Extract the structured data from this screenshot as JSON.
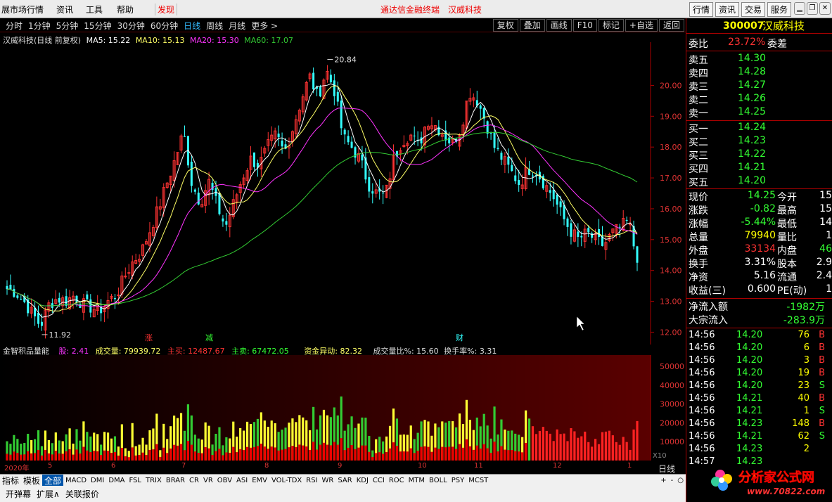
{
  "menu": {
    "items": [
      "展市场行情",
      "资讯",
      "工具",
      "帮助",
      "发现"
    ],
    "center1": "通达信金融终端",
    "center2": "汉威科技",
    "right_tabs": [
      "行情",
      "资讯",
      "交易",
      "服务"
    ]
  },
  "periods": [
    "分时",
    "1分钟",
    "5分钟",
    "15分钟",
    "30分钟",
    "60分钟",
    "日线",
    "周线",
    "月线",
    "更多 >"
  ],
  "active_period": "日线",
  "tools": [
    "复权",
    "叠加",
    "画线",
    "F10",
    "标记",
    "+自选",
    "返回"
  ],
  "chart_info": {
    "name": "汉威科技(日线 前复权)",
    "ma5": "MA5: 15.22",
    "ma10": "MA10: 15.13",
    "ma20": "MA20: 15.30",
    "ma60": "MA60: 17.07"
  },
  "colors": {
    "up": "#ff3333",
    "down": "#33ffff",
    "ma5": "#ffffff",
    "ma10": "#ffff66",
    "ma20": "#ff33ff",
    "ma60": "#33cc33"
  },
  "annotations": {
    "high": "20.84",
    "low": "11.92",
    "marks": [
      "涨",
      "减",
      "财"
    ]
  },
  "indicator": {
    "name": "金智积品量能",
    "gu": "股: 2.41",
    "vol": "成交量: 79939.72",
    "buy": "主买: 12487.67",
    "sell": "主卖: 67472.05",
    "fund": "资金异动: 82.32",
    "ratio": "成交量比%: 15.60",
    "turnover": "换手率%: 3.31"
  },
  "vol_axis_scale": "X10",
  "date_labels": [
    "2020年",
    "5",
    "6",
    "7",
    "8",
    "9",
    "10",
    "11",
    "12",
    "1"
  ],
  "day_label": "日线",
  "ind_tabs": [
    "指标",
    "模板",
    "全部",
    "MACD",
    "DMI",
    "DMA",
    "FSL",
    "TRIX",
    "BRAR",
    "CR",
    "VR",
    "OBV",
    "ASI",
    "EMV",
    "VOL-TDX",
    "RSI",
    "WR",
    "SAR",
    "KDJ",
    "CCI",
    "ROC",
    "MTM",
    "BOLL",
    "PSY",
    "MCST"
  ],
  "bottom": [
    "开弹幕",
    "扩展∧",
    "关联报价"
  ],
  "stock": {
    "code": "300007",
    "name": "汉威科技",
    "weibi_label": "委比",
    "weibi": "23.72%",
    "weicha_label": "委差"
  },
  "asks": [
    {
      "label": "卖五",
      "price": "14.30"
    },
    {
      "label": "卖四",
      "price": "14.28"
    },
    {
      "label": "卖三",
      "price": "14.27"
    },
    {
      "label": "卖二",
      "price": "14.26"
    },
    {
      "label": "卖一",
      "price": "14.25"
    }
  ],
  "bids": [
    {
      "label": "买一",
      "price": "14.24"
    },
    {
      "label": "买二",
      "price": "14.23"
    },
    {
      "label": "买三",
      "price": "14.22"
    },
    {
      "label": "买四",
      "price": "14.21"
    },
    {
      "label": "买五",
      "price": "14.20"
    }
  ],
  "quote": [
    {
      "l1": "现价",
      "v1": "14.25",
      "l2": "今开",
      "v2": "15"
    },
    {
      "l1": "涨跌",
      "v1": "-0.82",
      "l2": "最高",
      "v2": "15"
    },
    {
      "l1": "涨幅",
      "v1": "-5.44%",
      "l2": "最低",
      "v2": "14"
    },
    {
      "l1": "总量",
      "v1": "79940",
      "l2": "量比",
      "v2": "1"
    },
    {
      "l1": "外盘",
      "v1": "33134",
      "l2": "内盘",
      "v2": "46"
    },
    {
      "l1": "换手",
      "v1": "3.31%",
      "l2": "股本",
      "v2": "2.9"
    },
    {
      "l1": "净资",
      "v1": "5.16",
      "l2": "流通",
      "v2": "2.4"
    },
    {
      "l1": "收益(三)",
      "v1": "0.600",
      "l2": "PE(动)",
      "v2": "1"
    }
  ],
  "flow": [
    {
      "label": "净流入额",
      "value": "-1982万"
    },
    {
      "label": "大宗流入",
      "value": "-283.9万"
    }
  ],
  "ticks": [
    {
      "t": "14:56",
      "p": "14.20",
      "v": "76",
      "d": "B"
    },
    {
      "t": "14:56",
      "p": "14.20",
      "v": "6",
      "d": "B"
    },
    {
      "t": "14:56",
      "p": "14.20",
      "v": "3",
      "d": "B"
    },
    {
      "t": "14:56",
      "p": "14.20",
      "v": "19",
      "d": "B"
    },
    {
      "t": "14:56",
      "p": "14.20",
      "v": "23",
      "d": "S"
    },
    {
      "t": "14:56",
      "p": "14.21",
      "v": "40",
      "d": "B"
    },
    {
      "t": "14:56",
      "p": "14.21",
      "v": "1",
      "d": "S"
    },
    {
      "t": "14:56",
      "p": "14.23",
      "v": "148",
      "d": "B"
    },
    {
      "t": "14:56",
      "p": "14.21",
      "v": "62",
      "d": "S"
    },
    {
      "t": "14:56",
      "p": "14.23",
      "v": "2",
      "d": ""
    },
    {
      "t": "14:57",
      "p": "14.23",
      "v": "",
      "d": ""
    }
  ],
  "watermark": {
    "text1": "分析家公式网",
    "text2": "www.70822.com"
  },
  "chart_data": {
    "type": "candlestick",
    "price_ticks": [
      "20.00",
      "19.00",
      "18.00",
      "17.00",
      "16.00",
      "15.00",
      "14.00",
      "13.00",
      "12.00"
    ],
    "ylim": [
      11.6,
      21.4
    ],
    "close_path": [
      13.4,
      13.3,
      13.0,
      12.6,
      12.2,
      12.9,
      13.1,
      13.0,
      13.2,
      12.9,
      12.8,
      12.7,
      13.0,
      13.2,
      13.8,
      14.3,
      14.6,
      15.3,
      16.0,
      16.8,
      17.6,
      18.5,
      16.8,
      16.2,
      16.9,
      16.1,
      15.4,
      16.2,
      17.0,
      17.6,
      17.4,
      18.0,
      18.4,
      17.8,
      18.6,
      19.5,
      20.3,
      19.6,
      20.5,
      19.8,
      18.3,
      18.0,
      17.6,
      16.8,
      16.5,
      16.4,
      17.6,
      18.2,
      18.4,
      18.0,
      18.9,
      18.7,
      18.4,
      18.1,
      18.6,
      19.8,
      19.5,
      18.8,
      18.0,
      17.6,
      17.2,
      16.8,
      17.3,
      17.2,
      16.8,
      16.4,
      15.8,
      15.3,
      15.0,
      15.2,
      15.0,
      14.8,
      15.2,
      15.4,
      15.6,
      14.25
    ],
    "vol_ticks": [
      "50000",
      "40000",
      "30000",
      "20000",
      "10000"
    ],
    "vol_max": 56000
  }
}
